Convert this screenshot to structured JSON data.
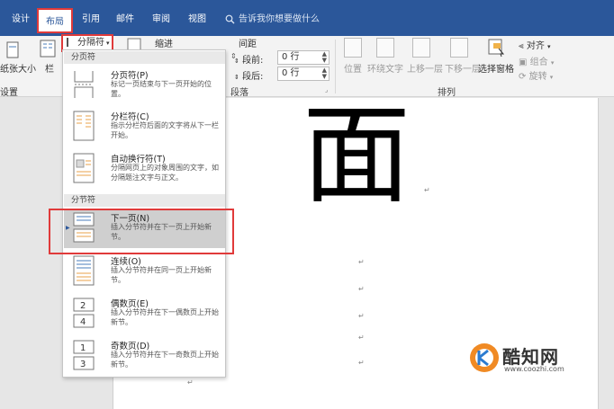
{
  "tabs": [
    {
      "label": "设计",
      "active": false
    },
    {
      "label": "布局",
      "active": true
    },
    {
      "label": "引用",
      "active": false
    },
    {
      "label": "邮件",
      "active": false
    },
    {
      "label": "审阅",
      "active": false
    },
    {
      "label": "视图",
      "active": false
    }
  ],
  "tell_me": "告诉我你想要做什么",
  "ribbon": {
    "paper_size": "纸张大小",
    "columns": "栏",
    "page_setup_label": "设置",
    "breaks_button": "分隔符",
    "indent_label": "缩进",
    "spacing_label": "间距",
    "before_label": "段前:",
    "before_value": "0 行",
    "after_label": "段后:",
    "after_value": "0 行",
    "paragraph_label": "段落",
    "position": "位置",
    "wrap_text": "环绕文字",
    "bring_forward": "上移一层",
    "send_backward": "下移一层",
    "selection_pane": "选择窗格",
    "align": "对齐",
    "group": "组合",
    "rotate": "旋转",
    "arrange_label": "排列"
  },
  "menu": {
    "page_breaks_header": "分页符",
    "section_breaks_header": "分节符",
    "items": [
      {
        "title": "分页符(P)",
        "desc": "标记一页结束与下一页开始的位置。"
      },
      {
        "title": "分栏符(C)",
        "desc": "指示分栏符后面的文字将从下一栏开始。"
      },
      {
        "title": "自动换行符(T)",
        "desc": "分隔网页上的对象周围的文字，如分隔题注文字与正文。"
      },
      {
        "title": "下一页(N)",
        "desc": "插入分节符并在下一页上开始新节。"
      },
      {
        "title": "连续(O)",
        "desc": "插入分节符并在同一页上开始新节。"
      },
      {
        "title": "偶数页(E)",
        "desc": "插入分节符并在下一偶数页上开始新节。"
      },
      {
        "title": "奇数页(D)",
        "desc": "插入分节符并在下一奇数页上开始新节。"
      }
    ]
  },
  "document": {
    "big_char": "面",
    "para_mark": "↵"
  },
  "watermark": {
    "name": "酷知网",
    "url": "www.coozhi.com"
  },
  "colors": {
    "ribbon_blue": "#2b579a",
    "highlight_red": "#e03a3a",
    "watermark_orange": "#f08a24",
    "watermark_blue": "#2b7bd0"
  }
}
